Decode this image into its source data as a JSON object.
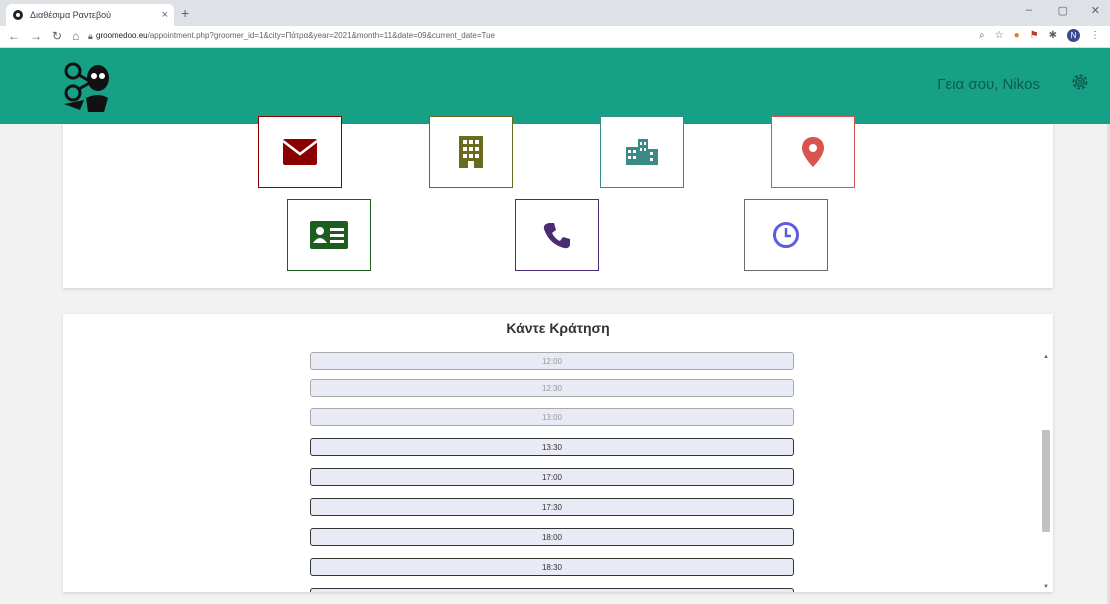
{
  "browser": {
    "tab_title": "Διαθέσιμα Ραντεβού",
    "tab_close": "×",
    "new_tab": "+",
    "url_host": "groomedoo.eu",
    "url_path": "/appointment.php?groomer_id=1&city=Πάτρα&year=2021&month=11&date=09&current_date=Tue",
    "profile_initial": "N"
  },
  "header": {
    "greeting": "Γεια σου, Nikos",
    "brand_color": "#16a085"
  },
  "icons": [
    {
      "name": "envelope-icon",
      "color": "#8b0000"
    },
    {
      "name": "building-icon",
      "color": "#6b6b1f"
    },
    {
      "name": "city-icon",
      "color": "#3b8a8a"
    },
    {
      "name": "map-marker-icon",
      "color": "#d9534f"
    },
    {
      "name": "id-card-icon",
      "color": "#1b5e20"
    },
    {
      "name": "phone-icon",
      "color": "#4a2c72"
    },
    {
      "name": "clock-icon",
      "color": "#5c5ce0"
    }
  ],
  "booking": {
    "title": "Κάντε Κράτηση",
    "slots": [
      {
        "time": "12:00",
        "available": false
      },
      {
        "time": "12:30",
        "available": false
      },
      {
        "time": "13:00",
        "available": false
      },
      {
        "time": "13:30",
        "available": true
      },
      {
        "time": "17:00",
        "available": true
      },
      {
        "time": "17:30",
        "available": true
      },
      {
        "time": "18:00",
        "available": true
      },
      {
        "time": "18:30",
        "available": true
      }
    ]
  }
}
